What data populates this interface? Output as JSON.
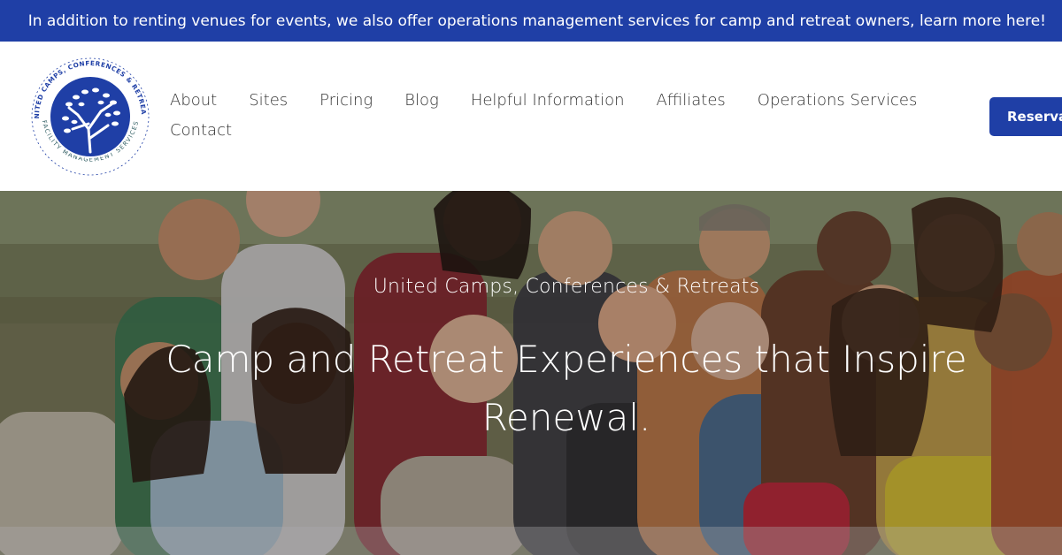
{
  "announcement": {
    "text": "In addition to renting venues for events, we also offer operations management services for camp and retreat owners, learn more here!"
  },
  "logo": {
    "top_text": "UNITED CAMPS, CONFERENCES & RETREATS",
    "bottom_text": "FACILITY MANAGEMENT SERVICES",
    "brand_color": "#1f3fa6"
  },
  "nav": {
    "items": [
      "About",
      "Sites",
      "Pricing",
      "Blog",
      "Helpful Information",
      "Affiliates",
      "Operations Services",
      "Contact"
    ]
  },
  "header": {
    "cta_label": "Reservat"
  },
  "hero": {
    "subtitle": "United Camps, Conferences & Retreats",
    "title": "Camp and Retreat Experiences that Inspire Renewal."
  },
  "colors": {
    "primary": "#1f3fa6",
    "text": "#333333",
    "background": "#ffffff"
  }
}
